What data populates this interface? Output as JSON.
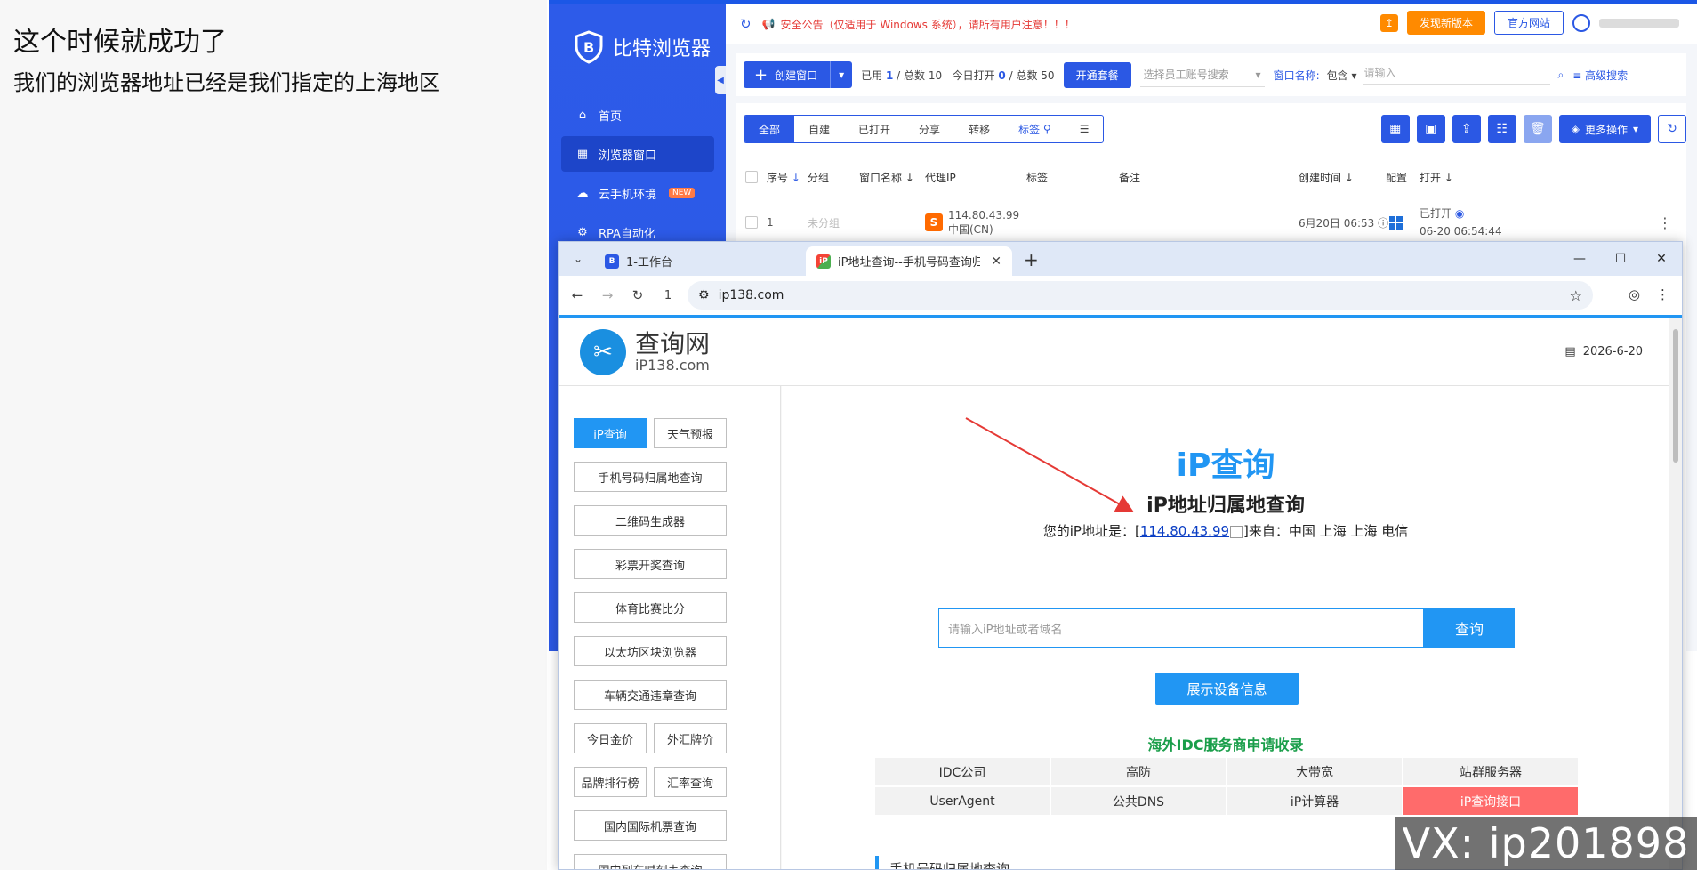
{
  "caption": {
    "title": "这个时候就成功了",
    "subtitle": "我们的浏览器地址已经是我们指定的上海地区"
  },
  "bit": {
    "logo_text": "比特浏览器",
    "nav": [
      {
        "label": "首页",
        "icon": "home-icon"
      },
      {
        "label": "浏览器窗口",
        "icon": "grid-icon"
      },
      {
        "label": "云手机环境",
        "icon": "cloud-icon",
        "badge": "NEW"
      },
      {
        "label": "RPA自动化",
        "icon": "robot-icon"
      }
    ],
    "notice": "安全公告（仅适用于 Windows 系统），请所有用户注意！！！",
    "update_button": "发现新版本",
    "site_button": "官方网站",
    "create_button": "创建窗口",
    "stats": {
      "used_label": "已用",
      "used": "1",
      "total_label": "/ 总数",
      "total": "10",
      "today_label": "今日打开",
      "today": "0",
      "today_total_label": "/ 总数",
      "today_total": "50"
    },
    "open_package": "开通套餐",
    "employee_select_placeholder": "选择员工账号搜索",
    "window_name_label": "窗口名称:",
    "contains": "包含",
    "search_placeholder": "请输入",
    "advanced": "高级搜索",
    "tabs": [
      "全部",
      "自建",
      "已打开",
      "分享",
      "转移",
      "标签"
    ],
    "more_ops": "更多操作",
    "columns": [
      "序号",
      "分组",
      "窗口名称",
      "代理IP",
      "标签",
      "备注",
      "创建时间",
      "配置",
      "打开"
    ],
    "row": {
      "index": "1",
      "group": "未分组",
      "proxy_ip": "114.80.43.99",
      "proxy_country": "中国(CN)",
      "created": "6月20日 06:53",
      "open_status": "已打开",
      "open_time": "06-20 06:54:44"
    }
  },
  "chrome": {
    "tabs": [
      {
        "title": "1-工作台"
      },
      {
        "title": "iP地址查询--手机号码查询归属"
      }
    ],
    "url_prefix": "1",
    "url": "ip138.com"
  },
  "site": {
    "name": "查询网",
    "domain": "iP138.com",
    "date": "2026-6-20",
    "left_buttons": [
      {
        "label": "iP查询",
        "active": true
      },
      {
        "label": "天气预报"
      },
      {
        "label": "手机号码归属地查询"
      },
      {
        "label": "二维码生成器"
      },
      {
        "label": "彩票开奖查询"
      },
      {
        "label": "体育比赛比分"
      },
      {
        "label": "以太坊区块浏览器"
      },
      {
        "label": "车辆交通违章查询"
      },
      {
        "label": "今日金价"
      },
      {
        "label": "外汇牌价"
      },
      {
        "label": "品牌排行榜"
      },
      {
        "label": "汇率查询"
      },
      {
        "label": "国内国际机票查询"
      },
      {
        "label": "国内列车时刻表查询"
      }
    ],
    "main_title": "iP查询",
    "sub_title": "iP地址归属地查询",
    "ip_prefix": "您的iP地址是：[",
    "ip": "114.80.43.99",
    "ip_suffix": "]来自：中国 上海 上海 电信",
    "search_placeholder": "请输入iP地址或者域名",
    "search_button": "查询",
    "device_button": "展示设备信息",
    "idc_title": "海外IDC服务商申请收录",
    "idc_links": [
      "IDC公司",
      "高防",
      "大带宽",
      "站群服务器",
      "UserAgent",
      "公共DNS",
      "iP计算器",
      "iP查询接口"
    ],
    "phone_section": "手机号码归属地查询"
  },
  "watermark": "VX: ip201898",
  "colors": {
    "bit_blue": "#2b58e4",
    "site_blue": "#2196f3",
    "arrow_red": "#e53935",
    "idc_green": "#1a9e4a",
    "hot_red": "#ff6b6b"
  }
}
